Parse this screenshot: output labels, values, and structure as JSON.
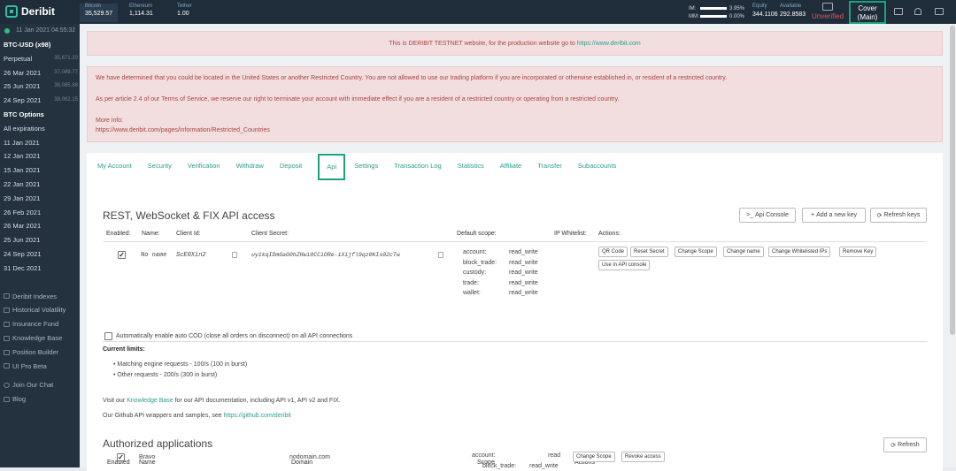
{
  "topbar": {
    "logo": "Deribit",
    "tickers": [
      {
        "name": "Bitcoin",
        "price": "35,529.57"
      },
      {
        "name": "Ethereum",
        "price": "1,114.31"
      },
      {
        "name": "Tether",
        "price": "1.00"
      }
    ],
    "account": {
      "im_label": "IM:",
      "im_pct": "3.95%",
      "mm_label": "MM:",
      "mm_pct": "0.00%"
    },
    "equity": {
      "label": "Equity",
      "value": "344.1106"
    },
    "available": {
      "label": "Available",
      "value": "292.8583"
    },
    "unverified": "Unverified",
    "cover_line1": "Cover",
    "cover_line2": "(Main)"
  },
  "sidebar": {
    "time": "11 Jan 2021 04:55:32",
    "futures_header": "BTC-USD (x98)",
    "futures": [
      {
        "label": "Perpetual",
        "price": "35,671.20"
      },
      {
        "label": "26 Mar 2021",
        "price": "37,089.77"
      },
      {
        "label": "25 Jun 2021",
        "price": "38,085.88"
      },
      {
        "label": "24 Sep 2021",
        "price": "38,082.15"
      }
    ],
    "options_header": "BTC Options",
    "options": [
      "All expirations",
      "11 Jan 2021",
      "12 Jan 2021",
      "15 Jan 2021",
      "22 Jan 2021",
      "29 Jan 2021",
      "26 Feb 2021",
      "26 Mar 2021",
      "25 Jun 2021",
      "24 Sep 2021",
      "31 Dec 2021"
    ],
    "links": [
      "Deribit Indexes",
      "Historical Volatility",
      "Insurance Fund",
      "Knowledge Base",
      "Position Builder",
      "UI Pro Beta",
      "Join Our Chat",
      "Blog"
    ]
  },
  "alerts": {
    "testnet_text": "This is DERIBIT TESTNET website, for the production website go to ",
    "testnet_link": "https://www.deribit.com",
    "restricted_1": "We have determined that you could be located in the United States or another Restricted Country. You are not allowed to use our trading platform if you are incorporated or otherwise established in, or resident of a restricted country.",
    "restricted_2": "As per article 2.4 of our Terms of Service, we reserve our right to terminate your account with immediate effect if you are a resident of a restricted country or operating from a restricted country.",
    "more_info": "More info:",
    "more_info_link": "https://www.deribit.com/pages/information/Restricted_Countries"
  },
  "tabs": [
    "My Account",
    "Security",
    "Verification",
    "Withdraw",
    "Deposit",
    "Api",
    "Settings",
    "Transaction Log",
    "Statistics",
    "Affiliate",
    "Transfer",
    "Subaccounts"
  ],
  "api": {
    "title": "REST, WebSocket & FIX API access",
    "btn_console": "Api Console",
    "btn_add": "Add a new key",
    "btn_refresh": "Refresh keys",
    "headers": {
      "enabled": "Enabled:",
      "name": "Name:",
      "client_id": "Client Id:",
      "client_secret": "Client Secret:",
      "scope": "Default scope:",
      "ip": "IP Whitelist:",
      "actions": "Actions:"
    },
    "row": {
      "name": "No name",
      "client_id": "ScE0Xin2",
      "client_secret": "uy1kqIDmGaG0hZHwi0CCiORe-1Xijfl9qz0KIs02cTw",
      "scopes": [
        {
          "k": "account:",
          "v": "read_write"
        },
        {
          "k": "block_trade:",
          "v": "read_write"
        },
        {
          "k": "custody:",
          "v": "read_write"
        },
        {
          "k": "trade:",
          "v": "read_write"
        },
        {
          "k": "wallet:",
          "v": "read_write"
        }
      ],
      "actions": [
        "QR Code",
        "Reset Secret",
        "Change Scope",
        "Change name",
        "Change Whitelisted IPs",
        "Remove Key",
        "Use in API console"
      ]
    },
    "auto_cod": "Automatically enable auto COD (close all orders on disconnect) on all API connections",
    "limits_title": "Current limits:",
    "limits": [
      "Matching engine requests - 100/s (100 in burst)",
      "Other requests - 200/s (300 in burst)"
    ],
    "visit_pre": "Visit our ",
    "visit_link": "Knowledge Base",
    "visit_post": " for our API documentation, including API v1, API v2 and FIX.",
    "github_pre": "Our Github API wrappers and samples, see ",
    "github_link": "https://github.com/deribit"
  },
  "authorized": {
    "title": "Authorized applications",
    "btn_refresh": "Refresh",
    "headers": {
      "enabled": "Enabled",
      "name": "Name",
      "domain": "Domain",
      "scope": "Scope",
      "actions": "Actions"
    },
    "row": {
      "name": "Bravo",
      "domain": "nodomain.com",
      "scope_k1": "account:",
      "scope_v1": "read",
      "scope_k2": "block_trade:",
      "scope_v2": "read_write",
      "actions": [
        "Change Scope",
        "Revoke access"
      ]
    }
  }
}
